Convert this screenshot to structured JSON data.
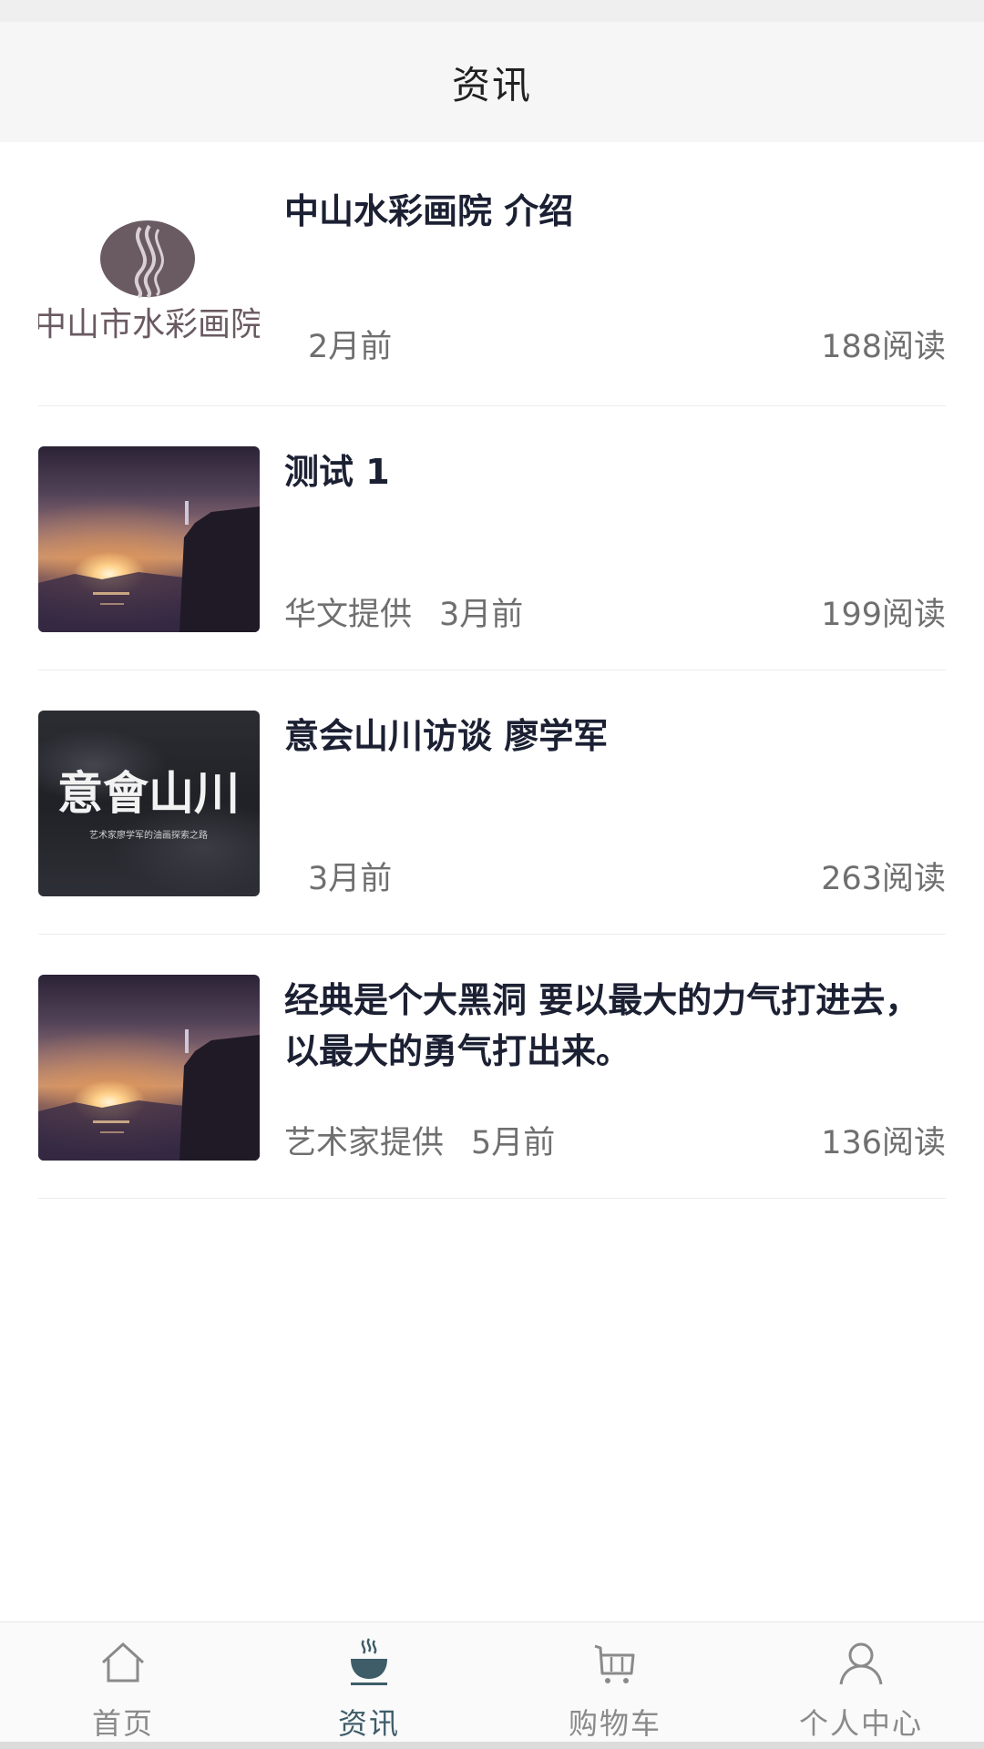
{
  "header": {
    "title": "资讯"
  },
  "articles": [
    {
      "title": "中山水彩画院 介绍",
      "source": "",
      "time": "2月前",
      "reads": "188阅读",
      "thumb": "logo",
      "logo_text": "中山市水彩画院"
    },
    {
      "title": "测试 1",
      "source": "华文提供",
      "time": "3月前",
      "reads": "199阅读",
      "thumb": "sunset"
    },
    {
      "title": "意会山川访谈 廖学军",
      "source": "",
      "time": "3月前",
      "reads": "263阅读",
      "thumb": "calligraphy",
      "image_text": "意會山川",
      "image_subtext": "艺术家廖学军的油画探索之路"
    },
    {
      "title": "经典是个大黑洞 要以最大的力气打进去，以最大的勇气打出来。",
      "source": "艺术家提供",
      "time": "5月前",
      "reads": "136阅读",
      "thumb": "sunset"
    }
  ],
  "tabbar": {
    "items": [
      {
        "label": "首页",
        "icon": "home-icon",
        "active": false
      },
      {
        "label": "资讯",
        "icon": "news-icon",
        "active": true
      },
      {
        "label": "购物车",
        "icon": "cart-icon",
        "active": false
      },
      {
        "label": "个人中心",
        "icon": "user-icon",
        "active": false
      }
    ]
  },
  "colors": {
    "active_tab": "#3e5d69",
    "inactive_tab": "#8a8a8a",
    "title": "#1c2033",
    "meta": "#6f6f6f"
  }
}
